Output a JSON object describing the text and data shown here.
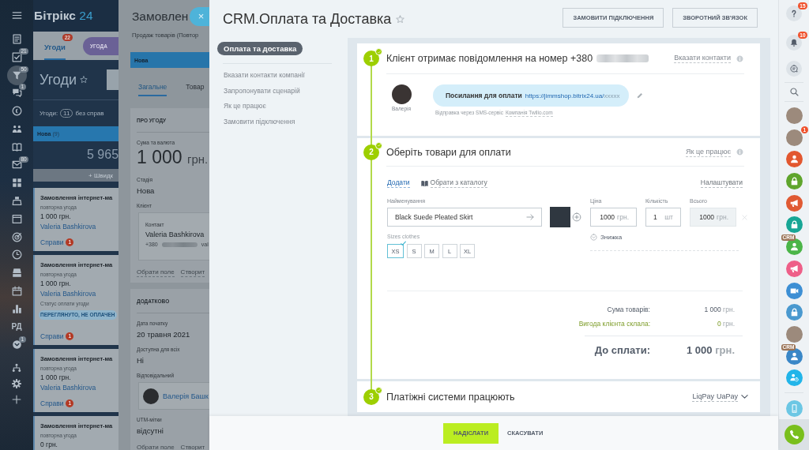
{
  "background_app": {
    "logo": {
      "name": "Бітрікс",
      "number": "24"
    },
    "left_menu": [
      {
        "selected": false
      },
      {
        "selected": false,
        "badge": "21"
      },
      {
        "selected": true,
        "badge": "50"
      },
      {
        "selected": false,
        "badge": "1"
      },
      {
        "selected": false
      },
      {
        "selected": false
      },
      {
        "selected": false
      },
      {
        "selected": false,
        "badge": "80"
      },
      {
        "selected": false
      },
      {
        "selected": false
      },
      {
        "selected": false
      },
      {
        "selected": false
      },
      {
        "selected": false
      },
      {
        "selected": false
      },
      {
        "selected": false
      },
      {
        "selected": false
      },
      {
        "selected": false,
        "label": "РД"
      },
      {
        "selected": false,
        "badge": "1"
      }
    ],
    "tabs": [
      {
        "label": "Угоди",
        "selected": true,
        "badge": "22"
      }
    ],
    "add_button": "УГОДА",
    "title": "Угоди",
    "counter": {
      "label": "Угоди:",
      "count": "11",
      "suffix": "без справ"
    },
    "column": {
      "title": "Нова",
      "count": "(9)",
      "sum": "5 965",
      "quick_add": "+ Швидк"
    },
    "cards": [
      {
        "title": "Замовлення інтернет-ма",
        "subtitle": "повторна угода",
        "amount": "1 000 грн.",
        "client": "Valeria Bashkirova",
        "activity": "Справи",
        "activity_count": "1"
      },
      {
        "title": "Замовлення інтернет-ма",
        "subtitle": "повторна угода",
        "amount": "1 000 грн.",
        "client": "Valeria Bashkirova",
        "status_label": "Статус оплати угоди",
        "status": "ПЕРЕГЛЯНУТО, НЕ ОПЛАЧЕН",
        "activity": "Справи",
        "activity_count": "1"
      },
      {
        "title": "Замовлення інтернет-ма",
        "subtitle": "повторна угода",
        "amount": "1 000 грн.",
        "client": "Valeria Bashkirova",
        "activity": "Справи",
        "activity_count": "1"
      },
      {
        "title": "Замовлення інтернет-ма",
        "subtitle": "повторна угода",
        "amount": "0 грн."
      }
    ]
  },
  "deal": {
    "title": "Замовлен",
    "subtitle": "Продаж товарів (Повтор",
    "stage": "Нова",
    "tabs": [
      {
        "label": "Загальне",
        "selected": true
      },
      {
        "label": "Товар",
        "selected": false
      }
    ],
    "sections": [
      {
        "title": "ПРО УГОДУ",
        "fields": [
          {
            "kind": "amount",
            "label": "Сума та валюта",
            "value": "1 000",
            "unit": "грн."
          },
          {
            "kind": "text",
            "label": "Стадія",
            "value": "Нова"
          },
          {
            "kind": "contact",
            "label": "Клієнт",
            "caption": "Контакт",
            "name": "Valeria Bashkirova",
            "phone": "+380",
            "email": "val"
          }
        ],
        "actions": [
          "Обрати поле",
          "Створит"
        ]
      },
      {
        "title": "ДОДАТКОВО",
        "fields": [
          {
            "kind": "text",
            "label": "Дата початку",
            "value": "20 травня 2021"
          },
          {
            "kind": "text",
            "label": "Доступна для всіх",
            "value": "Ні"
          },
          {
            "kind": "person",
            "label": "Відповідальний",
            "name": "Валерія Башк"
          },
          {
            "kind": "text",
            "label": "UTM-мітки",
            "value": "відсутні"
          }
        ],
        "actions": [
          "Обрати поле",
          "Створит"
        ]
      }
    ]
  },
  "crm": {
    "close": "×",
    "title": "CRM.Оплата та Доставка",
    "header_buttons": [
      "ЗАМОВИТИ ПІДКЛЮЧЕННЯ",
      "ЗВОРОТНИЙ ЗВ'ЯЗОК"
    ],
    "nav": {
      "title": "Оплата та доставка",
      "links": [
        "Вказати контакти компанії",
        "Запропонувати сценарій",
        "Як це працює",
        "Замовити підключення"
      ]
    },
    "steps": [
      {
        "kind": "message",
        "number": "1",
        "done": true,
        "title": "Клієнт отримає повідомлення на номер +380",
        "link": "Вказати контакти",
        "sender": "Валерія",
        "message": "Посилання для оплати",
        "url": "https://jimmshop.bitrix24.ua/",
        "url_tail": "xxxxx",
        "via": "Відправка через SMS-сервіс",
        "provider": "Компанія Twilio.com"
      },
      {
        "kind": "products",
        "number": "2",
        "done": true,
        "title": "Оберіть товари для оплати",
        "link": "Як це працює",
        "add": "Додати",
        "catalog": "Обрати з каталогу",
        "settings": "Налаштувати",
        "name_label": "Найменування",
        "name": "Black Suede Pleated Skirt",
        "fields": [
          {
            "label": "Ціна",
            "value": "1000",
            "unit": "грн.",
            "disabled": false
          },
          {
            "label": "Кількість",
            "value": "1",
            "unit": "шт",
            "disabled": false
          },
          {
            "label": "Всього",
            "value": "1000",
            "unit": "грн.",
            "disabled": true
          }
        ],
        "discount": "Знижка",
        "property": "Sizes clothes",
        "sizes": [
          {
            "label": "XS",
            "selected": true
          },
          {
            "label": "S",
            "selected": false
          },
          {
            "label": "M",
            "selected": false
          },
          {
            "label": "L",
            "selected": false
          },
          {
            "label": "XL",
            "selected": false
          }
        ],
        "totals": [
          {
            "kind": "sum",
            "label": "Сума товарів:",
            "value": "1 000",
            "currency": "грн."
          },
          {
            "kind": "saving",
            "label": "Вигода клієнта склала:",
            "value": "0",
            "currency": "грн."
          },
          {
            "kind": "due",
            "label": "До сплати:",
            "value": "1 000",
            "currency": "грн."
          }
        ]
      },
      {
        "kind": "payment",
        "number": "3",
        "done": true,
        "title": "Платіжні системи працюють",
        "systems": [
          "LiqPay",
          "UaPay"
        ]
      }
    ],
    "footer_buttons": [
      {
        "kind": "primary",
        "label": "НАДІСЛАТИ"
      },
      {
        "kind": "link",
        "label": "СКАСУВАТИ"
      }
    ]
  },
  "right_bar": {
    "help_badge": "15",
    "notifications_badge": "10",
    "contacts": [
      {
        "kind": "photo"
      },
      {
        "kind": "photo",
        "badge": "1"
      },
      {
        "kind": "icon",
        "color": "#e2572f"
      },
      {
        "kind": "icon",
        "color": "#5fa52c"
      },
      {
        "kind": "icon",
        "color": "#e05a33"
      },
      {
        "kind": "icon",
        "color": "#17a695"
      },
      {
        "kind": "icon",
        "color": "#4bb548",
        "tag": "CRM"
      },
      {
        "kind": "icon",
        "color": "#ee5f88"
      },
      {
        "kind": "icon",
        "color": "#3d8fd4"
      },
      {
        "kind": "icon",
        "color": "#4a99cf"
      },
      {
        "kind": "photo"
      },
      {
        "kind": "icon",
        "color": "#3a87c7",
        "tag": "CRM"
      },
      {
        "kind": "icon",
        "color": "#22b5e9"
      }
    ]
  }
}
